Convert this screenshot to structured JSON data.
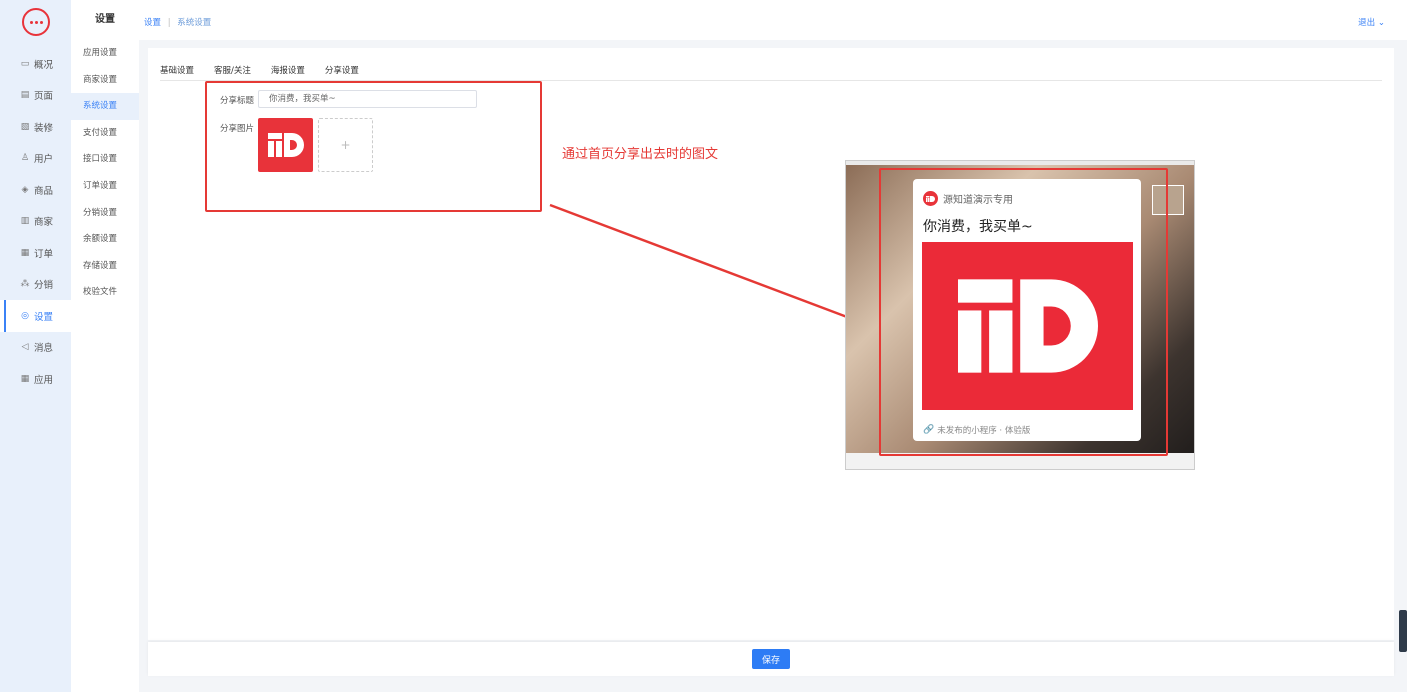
{
  "app": {
    "logo_icon": "chat-bubble-icon"
  },
  "primary_nav": [
    {
      "label": "概况",
      "icon": "▭"
    },
    {
      "label": "页面",
      "icon": "▤"
    },
    {
      "label": "装修",
      "icon": "▧"
    },
    {
      "label": "用户",
      "icon": "♙"
    },
    {
      "label": "商品",
      "icon": "◈"
    },
    {
      "label": "商家",
      "icon": "▥"
    },
    {
      "label": "订单",
      "icon": "▦"
    },
    {
      "label": "分销",
      "icon": "⁂"
    },
    {
      "label": "设置",
      "icon": "◎",
      "active": true
    },
    {
      "label": "消息",
      "icon": "◁"
    },
    {
      "label": "应用",
      "icon": "▦"
    }
  ],
  "secondary_nav": {
    "title": "设置",
    "items": [
      "应用设置",
      "商家设置",
      "系统设置",
      "支付设置",
      "接口设置",
      "订单设置",
      "分销设置",
      "余额设置",
      "存储设置",
      "校验文件"
    ]
  },
  "topbar": {
    "breadcrumb_root": "设置",
    "breadcrumb_sep": "|",
    "breadcrumb_current": "系统设置",
    "logout": "退出 ⌄"
  },
  "tabs": [
    "基础设置",
    "客服/关注",
    "海报设置",
    "分享设置"
  ],
  "form": {
    "share_title_label": "分享标题",
    "share_title_value": "你消费，我买单~",
    "share_image_label": "分享图片",
    "upload_plus": "+"
  },
  "annotation": "通过首页分享出去时的图文",
  "preview": {
    "app_name": "源知道演示专用",
    "title": "你消费，我买单~",
    "footer": "未发布的小程序 · 体验版"
  },
  "footer": {
    "save_label": "保存"
  },
  "colors": {
    "accent": "#2d7cf5",
    "brand_red": "#e8333a",
    "annotation_red": "#e53935"
  }
}
